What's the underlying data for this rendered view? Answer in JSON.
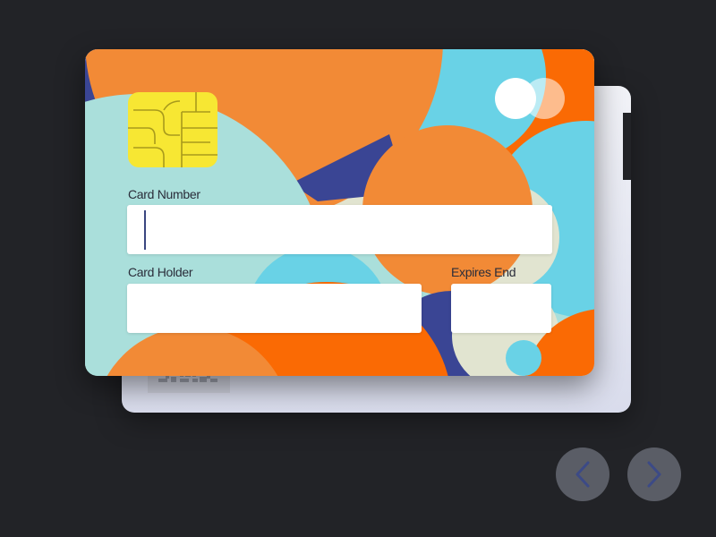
{
  "card_form": {
    "card_number": {
      "label": "Card Number",
      "value": "",
      "placeholder": ""
    },
    "card_holder": {
      "label": "Card Holder",
      "value": "",
      "placeholder": ""
    },
    "expires_end": {
      "label": "Expires End",
      "value": "",
      "placeholder": ""
    }
  },
  "icons": {
    "chip": "card-chip-icon",
    "brand": "mastercard-logo-icon",
    "prev": "chevron-left-icon",
    "next": "chevron-right-icon",
    "qr": "qr-code-icon"
  },
  "colors": {
    "background": "#222327",
    "card_orange": "#f28a36",
    "card_dark_orange": "#fa6a04",
    "card_cyan": "#69d2e6",
    "card_mint": "#aadfdb",
    "card_cream": "#e1e4d0",
    "card_navy": "#3a4594",
    "chip_yellow": "#f7e733",
    "nav_button": "#5a5d66",
    "nav_arrow": "#3c4a86"
  }
}
